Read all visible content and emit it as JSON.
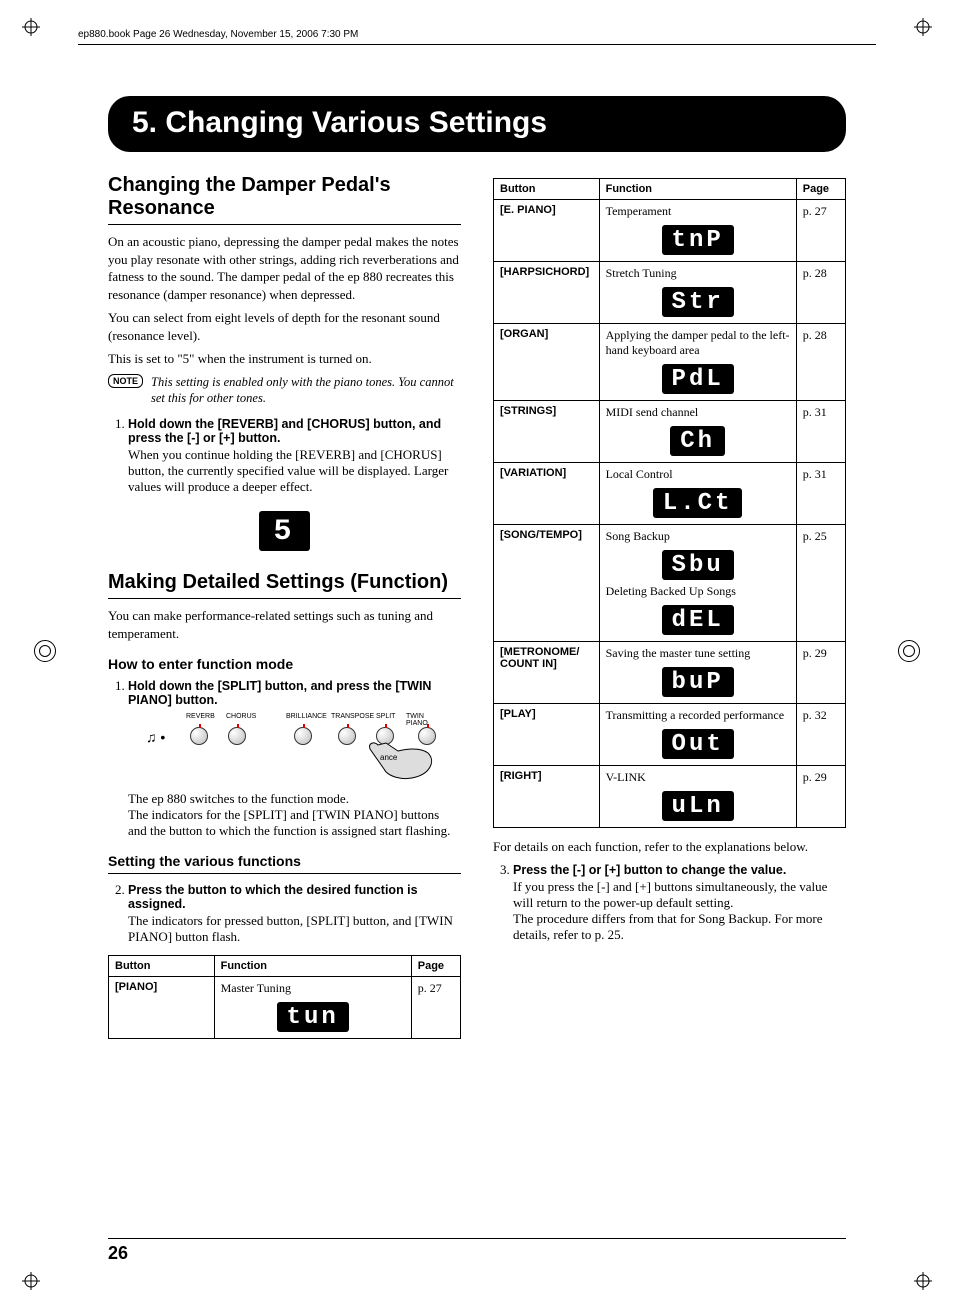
{
  "header": "ep880.book  Page 26  Wednesday, November 15, 2006  7:30 PM",
  "chapter": "5. Changing Various Settings",
  "pageNumber": "26",
  "sec1": {
    "title": "Changing the Damper Pedal's Resonance",
    "p1": "On an acoustic piano, depressing the damper pedal makes the notes you play resonate with other strings, adding rich reverberations and fatness to the sound. The damper pedal of the ep 880 recreates this resonance (damper resonance) when depressed.",
    "p2": "You can select from eight levels of depth for the resonant sound (resonance level).",
    "p3": "This is set to \"5\" when the instrument is turned on.",
    "noteLabel": "NOTE",
    "note": "This setting is enabled only with the piano tones. You cannot set this for other tones.",
    "step1head": "Hold down the [REVERB] and [CHORUS] button, and press the [-] or [+] button.",
    "step1body": "When you continue holding the [REVERB] and [CHORUS] button, the currently specified value will be displayed. Larger values will produce a deeper effect.",
    "lcd": "5"
  },
  "sec2": {
    "title": "Making Detailed Settings (Function)",
    "p1": "You can make performance-related settings such as tuning and temperament.",
    "sub1": "How to enter function mode",
    "step1head": "Hold down the [SPLIT] button, and press the [TWIN PIANO] button.",
    "illus": {
      "labels": [
        "REVERB",
        "CHORUS",
        "BRILLIANCE",
        "TRANSPOSE",
        "SPLIT",
        "TWIN PIANO"
      ],
      "caption": "ance"
    },
    "step1body": "The ep 880 switches to the function mode.\nThe indicators for the [SPLIT] and [TWIN PIANO] buttons and the button to which the function is assigned start flashing.",
    "sub2": "Setting the various functions",
    "step2head": "Press the button to which the desired function is assigned.",
    "step2body": "The indicators for pressed button, [SPLIT] button, and [TWIN PIANO] button flash."
  },
  "table1": {
    "headers": [
      "Button",
      "Function",
      "Page"
    ],
    "row": {
      "button": "[PIANO]",
      "func": "Master Tuning",
      "lcd": "tun",
      "page": "p. 27"
    }
  },
  "table2": {
    "headers": [
      "Button",
      "Function",
      "Page"
    ],
    "rows": [
      {
        "button": "[E. PIANO]",
        "func": "Temperament",
        "lcd": "tnP",
        "page": "p. 27"
      },
      {
        "button": "[HARPSICHORD]",
        "func": "Stretch Tuning",
        "lcd": "Str",
        "page": "p. 28"
      },
      {
        "button": "[ORGAN]",
        "func": "Applying the damper pedal to the left-hand keyboard area",
        "lcd": "PdL",
        "page": "p. 28"
      },
      {
        "button": "[STRINGS]",
        "func": "MIDI send channel",
        "lcd": "Ch",
        "page": "p. 31"
      },
      {
        "button": "[VARIATION]",
        "func": "Local Control",
        "lcd": "L.Ct",
        "page": "p. 31"
      },
      {
        "button": "[SONG/TEMPO]",
        "func": "Song Backup",
        "lcd": "Sbu",
        "func2": "Deleting Backed Up Songs",
        "lcd2": "dEL",
        "page": "p. 25"
      },
      {
        "button": "[METRONOME/ COUNT IN]",
        "func": "Saving the master tune setting",
        "lcd": "buP",
        "page": "p. 29"
      },
      {
        "button": "[PLAY]",
        "func": "Transmitting a recorded performance",
        "lcd": "Out",
        "page": "p. 32"
      },
      {
        "button": "[RIGHT]",
        "func": "V-LINK",
        "lcd": "uLn",
        "page": "p. 29"
      }
    ]
  },
  "afterTable": "For details on each function, refer to the explanations below.",
  "step3": {
    "head": "Press the [-] or [+] button to change the value.",
    "body": "If you press the [-] and [+] buttons simultaneously, the value will return to the power-up default setting.\nThe procedure differs from that for Song Backup. For more details, refer to p. 25."
  }
}
